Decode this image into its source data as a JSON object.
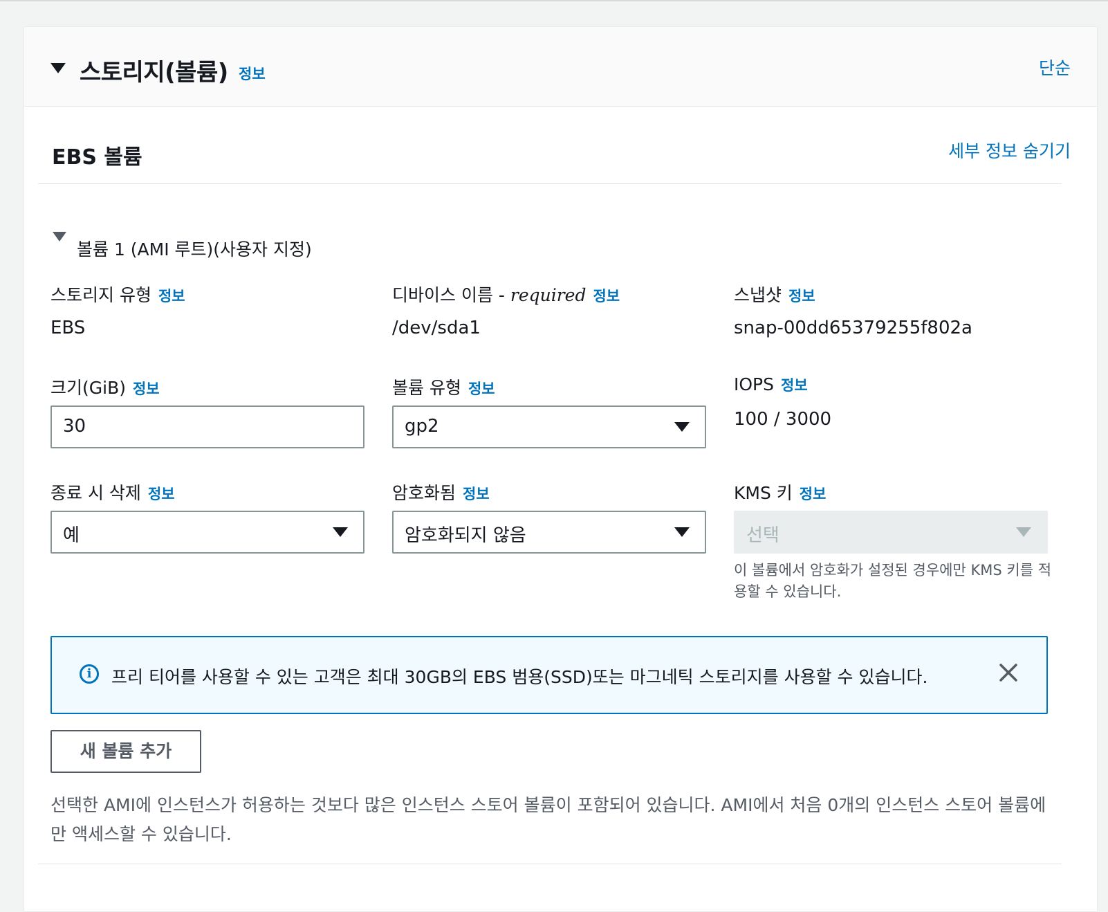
{
  "header": {
    "title": "스토리지(볼륨)",
    "info": "정보",
    "simple_link": "단순"
  },
  "ebs": {
    "title": "EBS 볼륨",
    "hide_details": "세부 정보 숨기기"
  },
  "volume": {
    "title": "볼륨 1 (AMI 루트)(사용자 지정)",
    "storage_type": {
      "label": "스토리지 유형",
      "info": "정보",
      "value": "EBS"
    },
    "device_name": {
      "label": "디바이스 이름 - ",
      "required": "required",
      "info": "정보",
      "value": "/dev/sda1"
    },
    "snapshot": {
      "label": "스냅샷",
      "info": "정보",
      "value": "snap-00dd65379255f802a"
    },
    "size": {
      "label": "크기(GiB)",
      "info": "정보",
      "value": "30"
    },
    "volume_type": {
      "label": "볼륨 유형",
      "info": "정보",
      "value": "gp2"
    },
    "iops": {
      "label": "IOPS",
      "info": "정보",
      "value": "100 / 3000"
    },
    "delete_on_termination": {
      "label": "종료 시 삭제",
      "info": "정보",
      "value": "예"
    },
    "encrypted": {
      "label": "암호화됨",
      "info": "정보",
      "value": "암호화되지 않음"
    },
    "kms_key": {
      "label": "KMS 키",
      "info": "정보",
      "placeholder": "선택",
      "help": "이 볼륨에서 암호화가 설정된 경우에만 KMS 키를 적용할 수 있습니다."
    }
  },
  "alert": {
    "text": "프리 티어를 사용할 수 있는 고객은 최대 30GB의 EBS 범용(SSD)또는 마그네틱 스토리지를 사용할 수 있습니다."
  },
  "add_volume_button": "새 볼륨 추가",
  "bottom_note": "선택한 AMI에 인스턴스가 허용하는 것보다 많은 인스턴스 스토어 볼륨이 포함되어 있습니다. AMI에서 처음 0개의 인스턴스 스토어 볼륨에만 액세스할 수 있습니다.",
  "colors": {
    "link": "#0073bb",
    "alert_bg": "#f1faff",
    "border": "#879596"
  }
}
